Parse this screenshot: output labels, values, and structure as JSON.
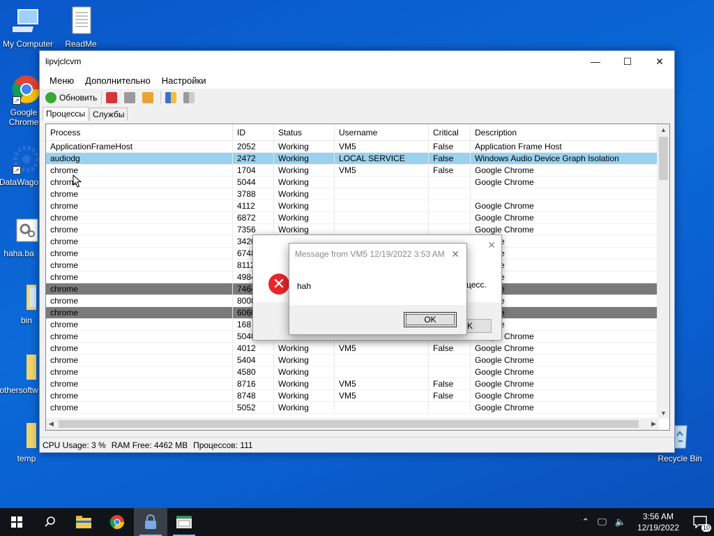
{
  "desktop": {
    "icons": [
      {
        "label": "My Computer",
        "icon": "computer-icon"
      },
      {
        "label": "ReadMe",
        "icon": "document-icon"
      },
      {
        "label": "Google Chrome",
        "icon": "chrome-icon"
      },
      {
        "label": "DataWago",
        "icon": "app-icon"
      },
      {
        "label": "haha.ba",
        "icon": "batch-file-icon"
      },
      {
        "label": "bin",
        "icon": "folder-icon"
      },
      {
        "label": "othersoftw",
        "icon": "folder-icon"
      },
      {
        "label": "temp",
        "icon": "folder-icon"
      },
      {
        "label": "Recycle Bin",
        "icon": "recycle-bin-icon"
      }
    ]
  },
  "window": {
    "title": "lipvjclcvm",
    "menu": [
      "Меню",
      "Дополнительно",
      "Настройки"
    ],
    "toolbar": {
      "refresh_label": "Обновить"
    },
    "tabs": [
      "Процессы",
      "Службы"
    ],
    "columns": [
      "Process",
      "ID",
      "Status",
      "Username",
      "Critical",
      "Description"
    ],
    "rows": [
      [
        "ApplicationFrameHost",
        "2052",
        "Working",
        "VM5",
        "False",
        "Application Frame Host"
      ],
      [
        "audiodg",
        "2472",
        "Working",
        "LOCAL SERVICE",
        "False",
        "Windows Audio Device Graph Isolation"
      ],
      [
        "chrome",
        "1704",
        "Working",
        "VM5",
        "False",
        "Google Chrome"
      ],
      [
        "chrome",
        "5044",
        "Working",
        "",
        "",
        "Google Chrome"
      ],
      [
        "chrome",
        "3788",
        "Working",
        "",
        "",
        ""
      ],
      [
        "chrome",
        "4112",
        "Working",
        "",
        "",
        "Google Chrome"
      ],
      [
        "chrome",
        "6872",
        "Working",
        "",
        "",
        "Google Chrome"
      ],
      [
        "chrome",
        "7356",
        "Working",
        "",
        "",
        "Google Chrome"
      ],
      [
        "chrome",
        "3420",
        "",
        "",
        "",
        "Chrome"
      ],
      [
        "chrome",
        "6748",
        "",
        "",
        "",
        "Chrome"
      ],
      [
        "chrome",
        "8112",
        "",
        "",
        "",
        "Chrome"
      ],
      [
        "chrome",
        "4984",
        "",
        "",
        "",
        "Chrome"
      ],
      [
        "chrome",
        "7464",
        "",
        "",
        "",
        "Chrome"
      ],
      [
        "chrome",
        "8008",
        "",
        "",
        "",
        "Chrome"
      ],
      [
        "chrome",
        "6060",
        "",
        "",
        "",
        "Chrome"
      ],
      [
        "chrome",
        "168",
        "",
        "",
        "",
        "Chrome"
      ],
      [
        "chrome",
        "5040",
        "",
        "",
        "",
        "Google Chrome"
      ],
      [
        "chrome",
        "4012",
        "Working",
        "VM5",
        "False",
        "Google Chrome"
      ],
      [
        "chrome",
        "5404",
        "Working",
        "",
        "",
        "Google Chrome"
      ],
      [
        "chrome",
        "4580",
        "Working",
        "",
        "",
        "Google Chrome"
      ],
      [
        "chrome",
        "8716",
        "Working",
        "VM5",
        "False",
        "Google Chrome"
      ],
      [
        "chrome",
        "8748",
        "Working",
        "VM5",
        "False",
        "Google Chrome"
      ],
      [
        "chrome",
        "5052",
        "Working",
        "",
        "",
        "Google Chrome"
      ]
    ],
    "selected_row": 1,
    "gray_rows": [
      12,
      14
    ],
    "status": {
      "cpu": "CPU Usage: 3 %",
      "ram": "RAM Free: 4462 MB",
      "processes": "Процессов: 111"
    }
  },
  "dialog_back": {
    "text_fragment": "цесс.",
    "ok_fragment": "K"
  },
  "dialog_front": {
    "title": "Message from VM5 12/19/2022 3:53 AM",
    "message": "hah",
    "ok_label": "OK"
  },
  "taskbar": {
    "clock_time": "3:56 AM",
    "clock_date": "12/19/2022",
    "notification_count": "10"
  },
  "colors": {
    "selection": "#99d1ee",
    "gray_selection": "#7a7a7a",
    "error": "#e8262a",
    "taskbar": "#101418"
  }
}
